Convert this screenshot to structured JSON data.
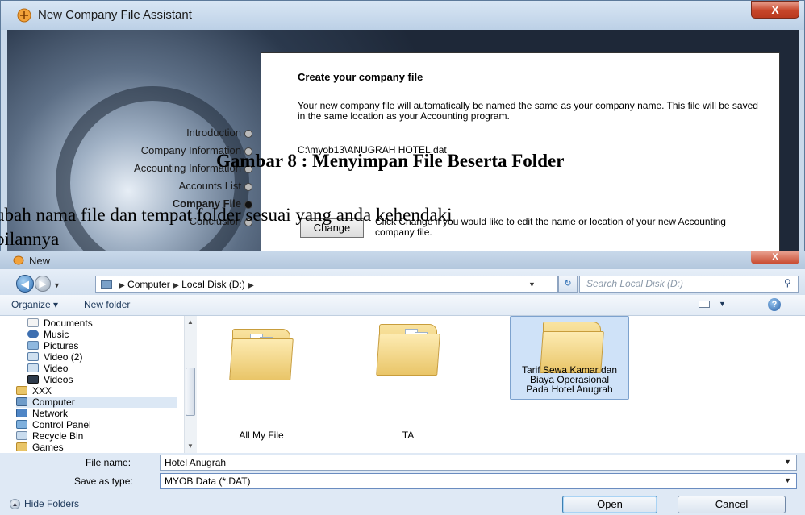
{
  "top_window": {
    "title": "New Company File Assistant",
    "close_glyph": "X",
    "steps": [
      {
        "label": "Introduction",
        "active": false
      },
      {
        "label": "Company Information",
        "active": false
      },
      {
        "label": "Accounting Information",
        "active": false
      },
      {
        "label": "Accounts List",
        "active": false
      },
      {
        "label": "Company File",
        "active": true
      },
      {
        "label": "Conclusion",
        "active": false
      }
    ],
    "panel": {
      "heading": "Create your company file",
      "description": "Your new company file will automatically be named the same as your company name.  This file will be saved in the same location as your Accounting program.",
      "path": "C:\\myob13\\ANUGRAH HOTEL.dat",
      "change_button": "Change",
      "change_description": "Click Change if you would like to edit the name or location of your new Accounting company file."
    }
  },
  "document_text": {
    "caption": "Gambar 8 : Menyimpan File Beserta Folder",
    "line1": "ubah nama file dan tempat folder sesuai yang anda kehendaki",
    "line2": "pilannya"
  },
  "save_dialog": {
    "title": "New",
    "close_glyph": "X",
    "address": {
      "crumbs": [
        "Computer",
        "Local Disk (D:)"
      ]
    },
    "search_placeholder": "Search Local Disk (D:)",
    "toolbar": {
      "organize": "Organize ▾",
      "new_folder": "New folder",
      "help": "?"
    },
    "nav_items": [
      {
        "label": "Documents",
        "icon": "documents-icon"
      },
      {
        "label": "Music",
        "icon": "music-icon"
      },
      {
        "label": "Pictures",
        "icon": "pictures-icon"
      },
      {
        "label": "Video (2)",
        "icon": "video-library-icon"
      },
      {
        "label": "Video",
        "icon": "video-library-icon"
      },
      {
        "label": "Videos",
        "icon": "videos-icon"
      },
      {
        "label": "XXX",
        "icon": "folder-icon"
      },
      {
        "label": "Computer",
        "icon": "computer-icon",
        "selected": true
      },
      {
        "label": "Network",
        "icon": "network-icon"
      },
      {
        "label": "Control Panel",
        "icon": "control-panel-icon"
      },
      {
        "label": "Recycle Bin",
        "icon": "recycle-bin-icon"
      },
      {
        "label": "Games",
        "icon": "games-icon"
      }
    ],
    "folders": [
      {
        "label": "All My File",
        "selected": false
      },
      {
        "label": "TA",
        "selected": false
      },
      {
        "label": "Tarif Sewa Kamar dan Biaya Operasional Pada Hotel Anugrah",
        "selected": true
      }
    ],
    "file_name_label": "File name:",
    "file_name_value": "Hotel Anugrah",
    "save_type_label": "Save as type:",
    "save_type_value": "MYOB Data (*.DAT)",
    "hide_folders": "Hide Folders",
    "open_button": "Open",
    "cancel_button": "Cancel"
  },
  "colors": {
    "accent": "#2f6fb5",
    "close_red": "#c7462a",
    "folder_yellow": "#e9c568",
    "selection": "#cfe2f8"
  }
}
